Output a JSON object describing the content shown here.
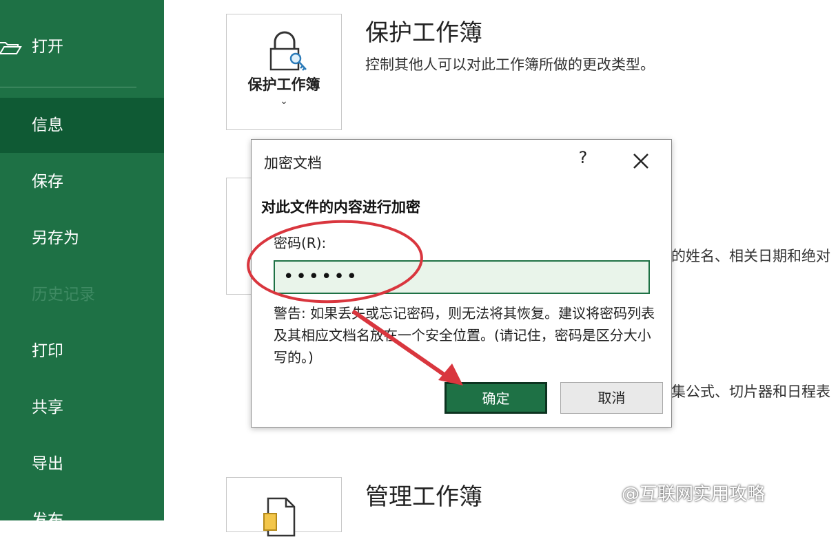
{
  "sidebar": {
    "items": [
      {
        "label": "打开",
        "state": "normal"
      },
      {
        "label": "信息",
        "state": "active"
      },
      {
        "label": "保存",
        "state": "normal"
      },
      {
        "label": "另存为",
        "state": "normal"
      },
      {
        "label": "历史记录",
        "state": "disabled"
      },
      {
        "label": "打印",
        "state": "normal"
      },
      {
        "label": "共享",
        "state": "normal"
      },
      {
        "label": "导出",
        "state": "normal"
      },
      {
        "label": "发布",
        "state": "normal"
      }
    ]
  },
  "protect": {
    "card_label": "保护工作簿",
    "title": "保护工作簿",
    "description": "控制其他人可以对此工作簿所做的更改类型。"
  },
  "inspect": {
    "partial_description": "的姓名、相关日期和绝对"
  },
  "compat": {
    "partial_description": "集公式、切片器和日程表"
  },
  "manage": {
    "title": "管理工作簿"
  },
  "dialog": {
    "title": "加密文档",
    "help_label": "?",
    "heading": "对此文件的内容进行加密",
    "password_label": "密码(R):",
    "password_value": "••••••",
    "warning": "警告: 如果丢失或忘记密码，则无法将其恢复。建议将密码列表及其相应文档名放在一个安全位置。(请记住，密码是区分大小写的。)",
    "ok_label": "确定",
    "cancel_label": "取消"
  },
  "watermark": "@互联网实用攻略",
  "colors": {
    "sidebar_bg": "#1e7145",
    "sidebar_active": "#0f5a34",
    "annotation_red": "#d9363e",
    "input_bg": "#e9f4ea"
  }
}
